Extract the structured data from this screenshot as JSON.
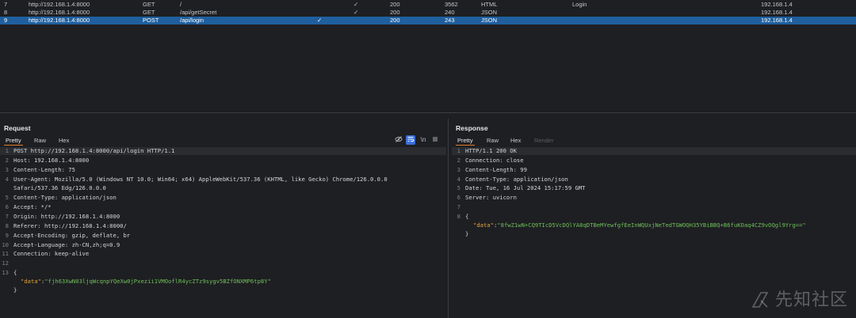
{
  "history": {
    "rows": [
      {
        "id": "7",
        "host": "http://192.168.1.4:8000",
        "method": "GET",
        "url": "/",
        "params": "✓",
        "edited": "",
        "status": "200",
        "length": "3562",
        "mime": "HTML",
        "title": "Login",
        "ip": "192.168.1.4",
        "selected": false
      },
      {
        "id": "8",
        "host": "http://192.168.1.4:8000",
        "method": "GET",
        "url": "/api/getSecret",
        "params": "✓",
        "edited": "",
        "status": "200",
        "length": "240",
        "mime": "JSON",
        "title": "",
        "ip": "192.168.1.4",
        "selected": false
      },
      {
        "id": "9",
        "host": "http://192.168.1.4:8000",
        "method": "POST",
        "url": "/api/login",
        "params": "",
        "edited": "✓",
        "status": "200",
        "length": "243",
        "mime": "JSON",
        "title": "",
        "ip": "192.168.1.4",
        "selected": true
      }
    ]
  },
  "request": {
    "title": "Request",
    "tabs": [
      "Pretty",
      "Raw",
      "Hex"
    ],
    "active_tab": "Pretty",
    "icons": [
      "eye-slash-icon",
      "wrap-icon",
      "newline-icon",
      "menu-icon"
    ],
    "line_numbers": [
      "1",
      "",
      "2",
      "3",
      "4",
      "",
      "5",
      "6",
      "7",
      "8",
      "9",
      "10",
      "11",
      "12",
      "13"
    ],
    "lines": [
      "POST http://192.168.1.4:8000/api/login HTTP/1.1",
      "Host: 192.168.1.4:8000",
      "Content-Length: 75",
      "User-Agent: Mozilla/5.0 (Windows NT 10.0; Win64; x64) AppleWebKit/537.36 (KHTML, like Gecko) Chrome/126.0.0.0",
      "Safari/537.36 Edg/126.0.0.0",
      "Content-Type: application/json",
      "Accept: */*",
      "Origin: http://192.168.1.4:8000",
      "Referer: http://192.168.1.4:8000/",
      "Accept-Encoding: gzip, deflate, br",
      "Accept-Language: zh-CN,zh;q=0.9",
      "Connection: keep-alive",
      "",
      "{",
      "}"
    ],
    "json_key": "\"data\"",
    "json_colon": ":",
    "json_value": "\"fjh63XwN03ljqWcqnpYQeXw0jPxezii1VMOoflR4ycZTz9sygv5BZfONXMP6tp8Y\""
  },
  "response": {
    "title": "Response",
    "tabs": [
      "Pretty",
      "Raw",
      "Hex",
      "Render"
    ],
    "active_tab": "Pretty",
    "line_numbers": [
      "1",
      "2",
      "3",
      "4",
      "5",
      "6",
      "7",
      "8"
    ],
    "lines": [
      "HTTP/1.1 200 OK",
      "Connection: close",
      "Content-Length: 99",
      "Content-Type: application/json",
      "Date: Tue, 16 Jul 2024 15:17:59 GMT",
      "Server: uvicorn",
      "",
      "{",
      "}"
    ],
    "json_key": "\"data\"",
    "json_colon": ":",
    "json_value": "\"8fwZ1wN+CQ9TIcD5VcDQlYA8qDTBeMYewfgfEeInWQUxjNeTedTGWOQH35YBiBBQ+B6fuKOaq4CZ9vOQgl9Yrg==\""
  },
  "watermark": {
    "text": "先知社区"
  },
  "colors": {
    "background": "#1e1f22",
    "selected_row": "#1f5f9e",
    "tab_underline": "#e07b2a",
    "json_key": "#e2a33b",
    "json_value": "#6fbf5a"
  }
}
